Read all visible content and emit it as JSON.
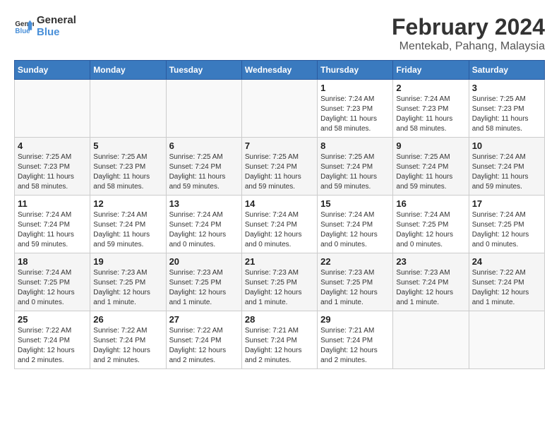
{
  "header": {
    "logo_line1": "General",
    "logo_line2": "Blue",
    "month_year": "February 2024",
    "location": "Mentekab, Pahang, Malaysia"
  },
  "weekdays": [
    "Sunday",
    "Monday",
    "Tuesday",
    "Wednesday",
    "Thursday",
    "Friday",
    "Saturday"
  ],
  "weeks": [
    [
      {
        "day": "",
        "info": ""
      },
      {
        "day": "",
        "info": ""
      },
      {
        "day": "",
        "info": ""
      },
      {
        "day": "",
        "info": ""
      },
      {
        "day": "1",
        "info": "Sunrise: 7:24 AM\nSunset: 7:23 PM\nDaylight: 11 hours\nand 58 minutes."
      },
      {
        "day": "2",
        "info": "Sunrise: 7:24 AM\nSunset: 7:23 PM\nDaylight: 11 hours\nand 58 minutes."
      },
      {
        "day": "3",
        "info": "Sunrise: 7:25 AM\nSunset: 7:23 PM\nDaylight: 11 hours\nand 58 minutes."
      }
    ],
    [
      {
        "day": "4",
        "info": "Sunrise: 7:25 AM\nSunset: 7:23 PM\nDaylight: 11 hours\nand 58 minutes."
      },
      {
        "day": "5",
        "info": "Sunrise: 7:25 AM\nSunset: 7:23 PM\nDaylight: 11 hours\nand 58 minutes."
      },
      {
        "day": "6",
        "info": "Sunrise: 7:25 AM\nSunset: 7:24 PM\nDaylight: 11 hours\nand 59 minutes."
      },
      {
        "day": "7",
        "info": "Sunrise: 7:25 AM\nSunset: 7:24 PM\nDaylight: 11 hours\nand 59 minutes."
      },
      {
        "day": "8",
        "info": "Sunrise: 7:25 AM\nSunset: 7:24 PM\nDaylight: 11 hours\nand 59 minutes."
      },
      {
        "day": "9",
        "info": "Sunrise: 7:25 AM\nSunset: 7:24 PM\nDaylight: 11 hours\nand 59 minutes."
      },
      {
        "day": "10",
        "info": "Sunrise: 7:24 AM\nSunset: 7:24 PM\nDaylight: 11 hours\nand 59 minutes."
      }
    ],
    [
      {
        "day": "11",
        "info": "Sunrise: 7:24 AM\nSunset: 7:24 PM\nDaylight: 11 hours\nand 59 minutes."
      },
      {
        "day": "12",
        "info": "Sunrise: 7:24 AM\nSunset: 7:24 PM\nDaylight: 11 hours\nand 59 minutes."
      },
      {
        "day": "13",
        "info": "Sunrise: 7:24 AM\nSunset: 7:24 PM\nDaylight: 12 hours\nand 0 minutes."
      },
      {
        "day": "14",
        "info": "Sunrise: 7:24 AM\nSunset: 7:24 PM\nDaylight: 12 hours\nand 0 minutes."
      },
      {
        "day": "15",
        "info": "Sunrise: 7:24 AM\nSunset: 7:24 PM\nDaylight: 12 hours\nand 0 minutes."
      },
      {
        "day": "16",
        "info": "Sunrise: 7:24 AM\nSunset: 7:25 PM\nDaylight: 12 hours\nand 0 minutes."
      },
      {
        "day": "17",
        "info": "Sunrise: 7:24 AM\nSunset: 7:25 PM\nDaylight: 12 hours\nand 0 minutes."
      }
    ],
    [
      {
        "day": "18",
        "info": "Sunrise: 7:24 AM\nSunset: 7:25 PM\nDaylight: 12 hours\nand 0 minutes."
      },
      {
        "day": "19",
        "info": "Sunrise: 7:23 AM\nSunset: 7:25 PM\nDaylight: 12 hours\nand 1 minute."
      },
      {
        "day": "20",
        "info": "Sunrise: 7:23 AM\nSunset: 7:25 PM\nDaylight: 12 hours\nand 1 minute."
      },
      {
        "day": "21",
        "info": "Sunrise: 7:23 AM\nSunset: 7:25 PM\nDaylight: 12 hours\nand 1 minute."
      },
      {
        "day": "22",
        "info": "Sunrise: 7:23 AM\nSunset: 7:25 PM\nDaylight: 12 hours\nand 1 minute."
      },
      {
        "day": "23",
        "info": "Sunrise: 7:23 AM\nSunset: 7:24 PM\nDaylight: 12 hours\nand 1 minute."
      },
      {
        "day": "24",
        "info": "Sunrise: 7:22 AM\nSunset: 7:24 PM\nDaylight: 12 hours\nand 1 minute."
      }
    ],
    [
      {
        "day": "25",
        "info": "Sunrise: 7:22 AM\nSunset: 7:24 PM\nDaylight: 12 hours\nand 2 minutes."
      },
      {
        "day": "26",
        "info": "Sunrise: 7:22 AM\nSunset: 7:24 PM\nDaylight: 12 hours\nand 2 minutes."
      },
      {
        "day": "27",
        "info": "Sunrise: 7:22 AM\nSunset: 7:24 PM\nDaylight: 12 hours\nand 2 minutes."
      },
      {
        "day": "28",
        "info": "Sunrise: 7:21 AM\nSunset: 7:24 PM\nDaylight: 12 hours\nand 2 minutes."
      },
      {
        "day": "29",
        "info": "Sunrise: 7:21 AM\nSunset: 7:24 PM\nDaylight: 12 hours\nand 2 minutes."
      },
      {
        "day": "",
        "info": ""
      },
      {
        "day": "",
        "info": ""
      }
    ]
  ]
}
